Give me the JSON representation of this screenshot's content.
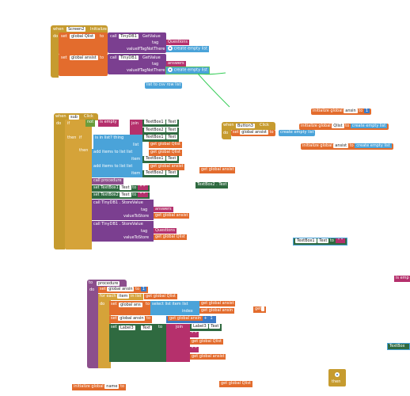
{
  "colors": {
    "event": "#c69b2f",
    "procedure": "#8c4f8c",
    "variable": "#e36c2d",
    "tinydb": "#7b3f90",
    "list": "#4aa3d9",
    "text": "#b5306c",
    "logic": "#6a9c3b",
    "control": "#d5a339",
    "textbox": "#2f6a40"
  },
  "screen_init": {
    "when": "when",
    "component": "Screen2",
    "event": "Initialize",
    "do": "do",
    "set1": "set",
    "var1": "global Qlist",
    "to1": "to",
    "call1": "call",
    "db1": "TinyDB1",
    "getvalue1": "GetValue",
    "tag1": "tag",
    "tagval1": "Questions",
    "ifnot1": "valueIfTagNotThere",
    "empty1": "create empty list",
    "set2": "set",
    "var2": "global ansist",
    "to2": "to",
    "call2": "call",
    "db2": "TinyDB1",
    "getvalue2": "GetValue",
    "tag2": "tag",
    "tagval2": "answers",
    "ifnot2": "valueIfTagNotThere",
    "empty2": "create empty list"
  },
  "loose_list_to_csv": "list to csv row  list",
  "init_ansin": {
    "init": "initialize global",
    "name": "ansin",
    "to": "to",
    "val": "1"
  },
  "button3": {
    "when": "when",
    "component": "Button3",
    "event": "Click",
    "init": "initialize global",
    "name": "Qlist",
    "to": "to",
    "empty": "create empty list",
    "do": "do",
    "set": "set",
    "var": "global ansist",
    "to2": "to",
    "empty2": "create empty list"
  },
  "init_ansist": {
    "init": "initialize global",
    "name": "ansist",
    "to": "to",
    "empty": "create empty list"
  },
  "sub_click": {
    "when": "when",
    "component": "sub",
    "event": "Click",
    "do": "do",
    "if": "if",
    "not": "not",
    "isempty": "is empty",
    "join": "join",
    "tb1": "TextBox1",
    "text1": "Text",
    "tb2": "TextBox2",
    "text2": "Text",
    "then": "then",
    "if2": "if",
    "isinlist": "is in list? thing",
    "tb1b": "TextBox1",
    "text3": "Text",
    "list": "list",
    "getq": "get global Qlist",
    "then2": "then",
    "add1": "add items to list  list",
    "getq2": "get global Qlist",
    "item1": "item",
    "tb1c": "TextBox1",
    "text4": "Text",
    "add2": "add items to list  list",
    "geta": "get global ansist",
    "item2": "item",
    "tb2b": "TextBox2",
    "text5": "Text",
    "callproc": "call procedure",
    "settb1": "set TextBox1",
    "text6": "Text",
    "to6": "to",
    "settb2": "set TextBox2",
    "text7": "Text",
    "to7": "to",
    "callstore1": "call TinyDB1 . StoreValue",
    "tag3": "tag",
    "tagval3": "answers",
    "vts1": "valueToStore",
    "geta2": "get global ansist",
    "callstore2": "call TinyDB1 . StoreValue",
    "tag4": "tag",
    "tagval4": "Questions",
    "vts2": "valueToStore",
    "getq3": "get global Qlist"
  },
  "loose_get_ansist": "get global ansist",
  "loose_tb2_text": "TextBox2 . Text",
  "loose_tb1_text": {
    "tb": "TextBox1",
    "text": "Text",
    "to": "to"
  },
  "is_empty_edge": "is emp",
  "procedure": {
    "to": "to",
    "name": "procedure",
    "do": "do",
    "set": "set",
    "var": "global ansin",
    "to1": "to",
    "val1": "1",
    "foreach": "for each",
    "item": "item",
    "inlist": "in list",
    "getq": "get global Qlist",
    "do2": "do",
    "set2": "set",
    "var2": "global ans",
    "to2": "to",
    "select": "select list item  list",
    "geta": "get global ansist",
    "index": "index",
    "getan": "get global ansin",
    "set3": "set",
    "var3": "global ansin",
    "to3": "to",
    "getan2": "get global ansin",
    "plus": "+",
    "val3": "1",
    "set4": "set",
    "label": "Label3",
    "text": "Text",
    "to4": "to",
    "join": "join",
    "label2": "Label3",
    "text2": "Text",
    "getq2": "get global Qlist",
    "getans": "get global ansist"
  },
  "loose_get_edge": "get",
  "loose_tb_edge": "TextBox",
  "init_name": {
    "init": "initialize global",
    "name": "name",
    "to": "to"
  },
  "loose_get_qlist": "get global Qlist",
  "then_block": "then"
}
